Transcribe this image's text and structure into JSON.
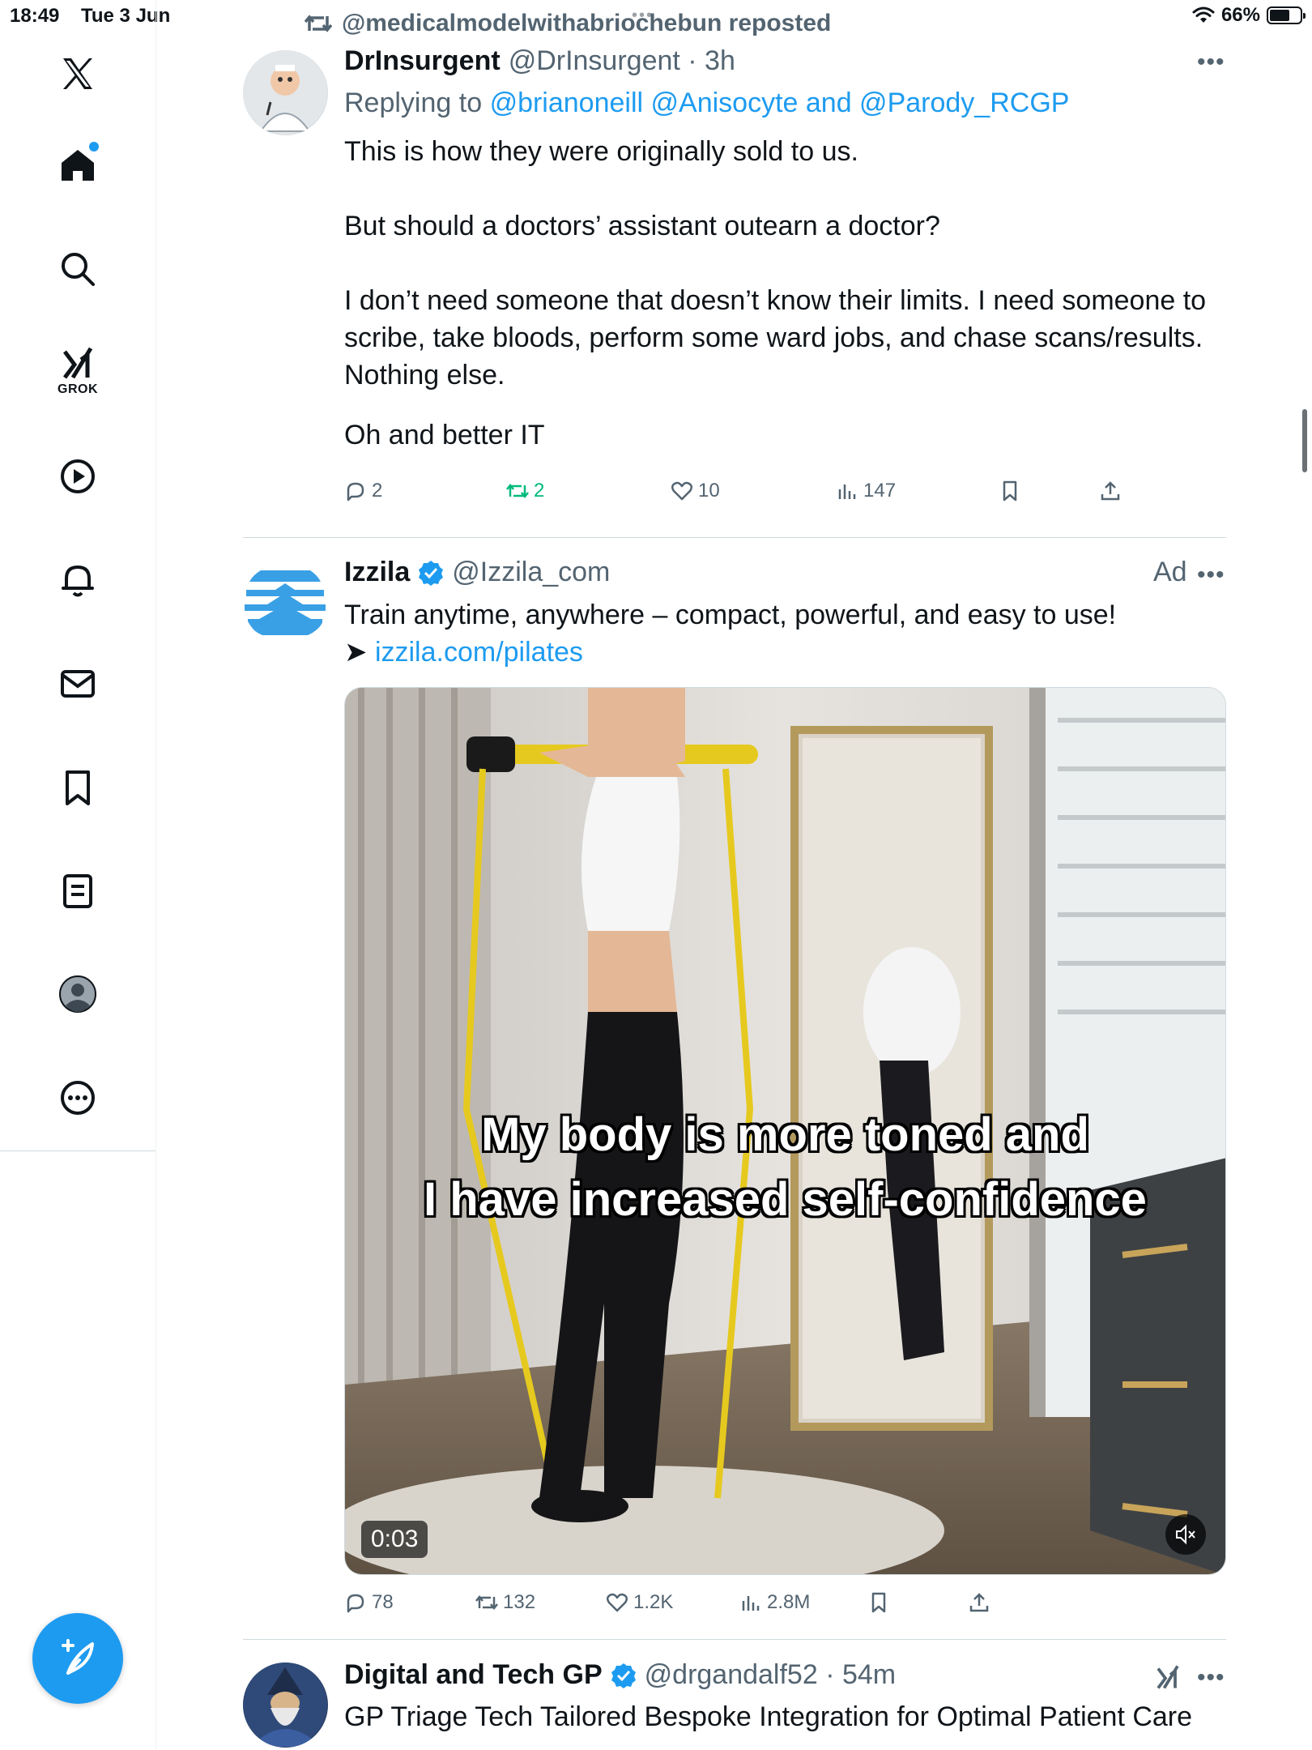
{
  "status_bar": {
    "time": "18:49",
    "date": "Tue 3 Jun",
    "dots": "•••",
    "battery": "66%",
    "battery_level": 0.66
  },
  "sidebar": {
    "items": [
      {
        "name": "x-logo-icon"
      },
      {
        "name": "home-icon"
      },
      {
        "name": "search-icon"
      },
      {
        "name": "grok-icon",
        "label": "GROK"
      },
      {
        "name": "video-icon"
      },
      {
        "name": "notifications-icon"
      },
      {
        "name": "messages-icon"
      },
      {
        "name": "bookmarks-icon"
      },
      {
        "name": "lists-icon"
      },
      {
        "name": "profile-icon"
      },
      {
        "name": "more-icon"
      }
    ],
    "compose_icon": "compose-post-icon"
  },
  "tweet1": {
    "repost_label": "@medicalmodelwithabriochebun reposted",
    "display_name": "DrInsurgent",
    "handle_time": "@DrInsurgent · 3h",
    "replying_prefix": "Replying to",
    "replying_to": "@brianoneill @Anisocyte and @Parody_RCGP",
    "paragraphs": [
      "This is how they were originally sold to us.",
      "But should a doctors’ assistant outearn a doctor?",
      "I don’t need someone that doesn’t know their limits. I need someone to",
      "scribe, take bloods, perform some ward jobs, and chase scans/results.",
      "Nothing else.",
      "Oh and better IT"
    ],
    "replies": "2",
    "reposts": "2",
    "likes": "10",
    "views": "147"
  },
  "tweet2": {
    "display_name": "Izzila",
    "handle": "@Izzila_com",
    "ad_label": "Ad",
    "text": "Train anytime, anywhere – compact, powerful, and easy to use!",
    "arrow": "➤",
    "link": "izzila.com/pilates",
    "video_caption_line1": "My body is more toned and",
    "video_caption_line2": "I have increased self-confidence",
    "video_duration": "0:03",
    "replies": "78",
    "reposts": "132",
    "likes": "1.2K",
    "views": "2.8M"
  },
  "tweet3": {
    "display_name": "Digital and Tech GP",
    "handle_time": "@drgandalf52 · 54m",
    "text": "GP Triage Tech Tailored Bespoke Integration for Optimal Patient Care"
  },
  "colors": {
    "accent": "#1d9bf0",
    "repost_green": "#00ba7c",
    "muted": "#536471"
  }
}
